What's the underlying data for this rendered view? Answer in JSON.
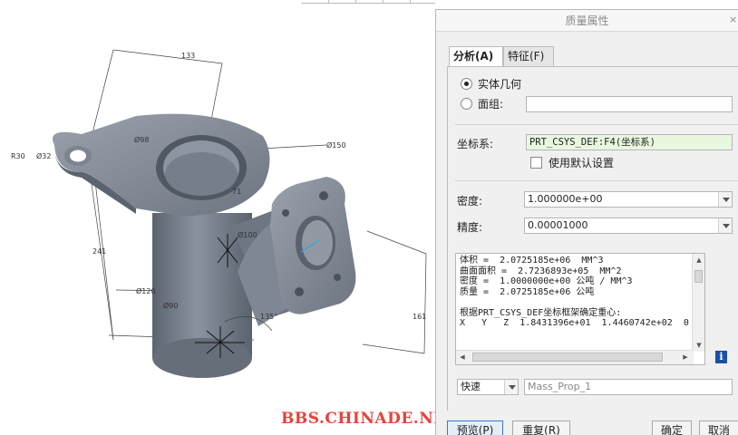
{
  "viewport": {
    "watermark": "BBS.CHINADE.NET",
    "dimensions": {
      "d133": "133",
      "r30": "R30",
      "d32": "Ø32",
      "d98": "Ø98",
      "d150": "Ø150",
      "d241": "241",
      "d120": "Ø120",
      "d90": "Ø90",
      "d100": "Ø100",
      "a135": "135°",
      "d161": "161",
      "d71": "71"
    }
  },
  "dialog": {
    "title": "质量属性",
    "close": "×",
    "tabs": [
      {
        "label": "分析(A)",
        "active": true
      },
      {
        "label": "特征(F)",
        "active": false
      }
    ],
    "solid_label": "实体几何",
    "quilt_label": "面组:",
    "quilt_value": "",
    "csys_label": "坐标系:",
    "csys_value": "PRT_CSYS_DEF:F4(坐标系)",
    "use_default_label": "使用默认设置",
    "density_label": "密度:",
    "density_value": "1.000000e+00",
    "precision_label": "精度:",
    "precision_value": "0.00001000",
    "results_text": "体积 =  2.0725185e+06  MM^3\n曲面面积 =  2.7236893e+05  MM^2\n密度 =  1.0000000e+00 公吨 / MM^3\n质量 =  2.0725185e+06 公吨\n\n根据PRT_CSYS_DEF坐标框架确定重心:\nX   Y   Z  1.8431396e+01  1.4460742e+02  0",
    "info_icon": "i",
    "mode_value": "快速",
    "name_value": "Mass_Prop_1",
    "buttons": {
      "preview": "预览(P)",
      "repeat": "重复(R)",
      "ok": "确定",
      "cancel": "取消"
    }
  },
  "colors": {
    "part_fill": "#7a8390",
    "accent": "#3a78c9",
    "watermark": "#e8413d",
    "csys_field": "#e9f7e0"
  }
}
